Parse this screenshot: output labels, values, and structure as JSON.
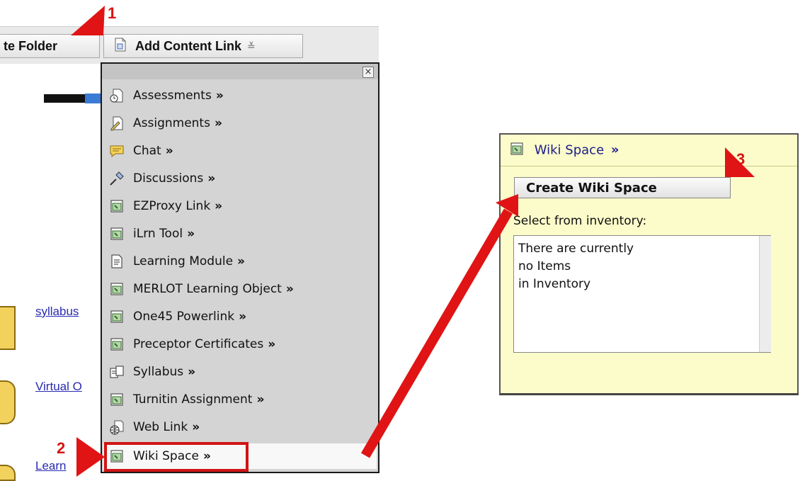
{
  "toolbar": {
    "create_folder_label": "te Folder",
    "add_content_link_label": "Add Content Link",
    "dropdown_caret": "≚"
  },
  "background_links": {
    "syllabus": "syllabus",
    "virtual": "Virtual O",
    "learner": "Learn"
  },
  "menu": {
    "close_glyph": "×",
    "arrow_glyph": "»",
    "items": [
      {
        "label": "Assessments",
        "icon": "assessments-icon"
      },
      {
        "label": "Assignments",
        "icon": "assignments-icon"
      },
      {
        "label": "Chat",
        "icon": "chat-icon"
      },
      {
        "label": "Discussions",
        "icon": "discussions-icon"
      },
      {
        "label": "EZProxy Link",
        "icon": "ezproxy-link-icon"
      },
      {
        "label": "iLrn Tool",
        "icon": "ilrn-tool-icon"
      },
      {
        "label": "Learning Module",
        "icon": "learning-module-icon"
      },
      {
        "label": "MERLOT Learning Object",
        "icon": "merlot-icon"
      },
      {
        "label": "One45 Powerlink",
        "icon": "one45-powerlink-icon"
      },
      {
        "label": "Preceptor Certificates",
        "icon": "preceptor-certificates-icon"
      },
      {
        "label": "Syllabus",
        "icon": "syllabus-icon"
      },
      {
        "label": "Turnitin Assignment",
        "icon": "turnitin-icon"
      },
      {
        "label": "Web Link",
        "icon": "web-link-icon"
      },
      {
        "label": "Wiki Space",
        "icon": "wiki-space-icon"
      }
    ],
    "selected_index": 13
  },
  "wiki_panel": {
    "title": "Wiki Space",
    "arrow_glyph": "»",
    "create_button_label": "Create Wiki Space",
    "select_label": "Select from inventory:",
    "inventory_text": "There are currently\nno Items\nin Inventory"
  },
  "callouts": {
    "one": "1",
    "two": "2",
    "three": "3"
  },
  "colors": {
    "callout_red": "#e01414",
    "panel_bg": "#fcfccb",
    "menu_bg": "#d4d4d4",
    "link_blue": "#2a2ab0"
  }
}
